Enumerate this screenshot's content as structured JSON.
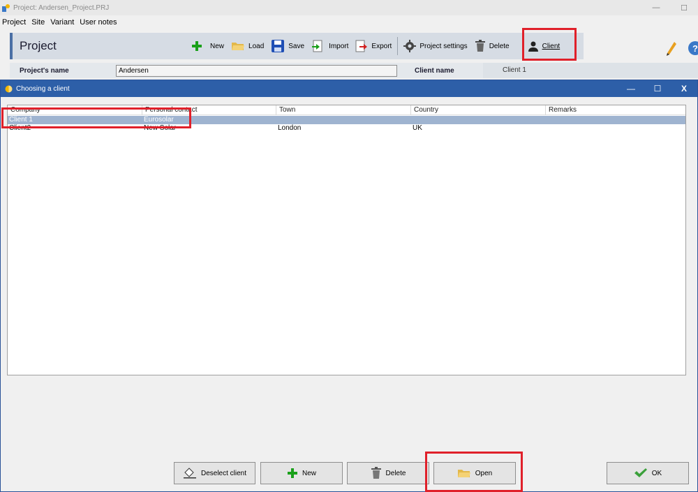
{
  "app": {
    "title": "Project:  Andersen_Project.PRJ",
    "window_buttons": [
      "—",
      "☐"
    ],
    "menu": [
      "Project",
      "Site",
      "Variant",
      "User notes"
    ]
  },
  "toolbar": {
    "panel_title": "Project",
    "buttons": {
      "new": "New",
      "load": "Load",
      "save": "Save",
      "import": "Import",
      "export": "Export",
      "project_settings": "Project settings",
      "delete": "Delete",
      "client": "Client"
    },
    "help_glyph": "?"
  },
  "project_row": {
    "name_label": "Project's name",
    "name_value": "Andersen",
    "client_label": "Client name",
    "client_value": "Client 1"
  },
  "dialog": {
    "title": "Choosing a client",
    "window_buttons": [
      "—",
      "☐",
      "X"
    ],
    "columns": [
      "Company",
      "Personal contact",
      "Town",
      "Country",
      "Remarks"
    ],
    "rows": [
      {
        "company": "Client 1",
        "contact": "Eurosolar",
        "town": "",
        "country": "",
        "remarks": "",
        "selected": true
      },
      {
        "company": "Client2",
        "contact": "New Solar",
        "town": "London",
        "country": "UK",
        "remarks": "",
        "selected": false
      }
    ],
    "buttons": {
      "deselect": "Deselect client",
      "new": "New",
      "delete": "Delete",
      "open": "Open",
      "ok": "OK"
    }
  },
  "colors": {
    "dialog_title_bg": "#2d5fa8",
    "selection_bg": "#9fb4d0",
    "highlight": "#e0202a",
    "toolbar_bg": "#d6dce4"
  }
}
